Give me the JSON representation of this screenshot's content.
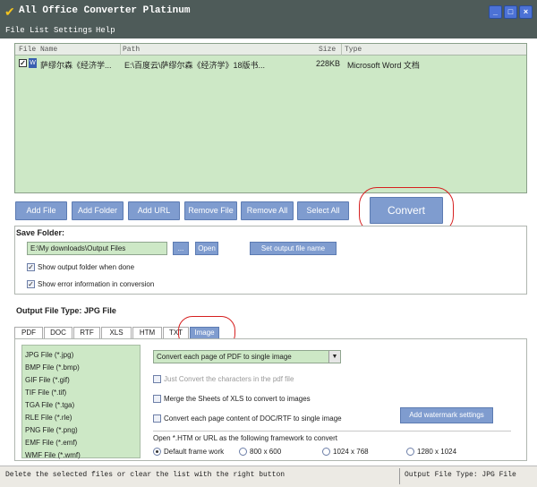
{
  "window": {
    "title": "All Office Converter Platinum",
    "minimize": "_",
    "maximize": "□",
    "close": "×"
  },
  "menu": [
    "File",
    "List",
    "Settings",
    "Help"
  ],
  "file_list": {
    "columns": [
      "File Name",
      "Path",
      "Size",
      "Type"
    ],
    "rows": [
      {
        "checked": true,
        "name": "萨缪尔森《经济学...",
        "path": "E:\\百度云\\萨缪尔森《经济学》18版书...",
        "size": "228KB",
        "type": "Microsoft Word 文档"
      }
    ]
  },
  "toolbar": {
    "add_file": "Add File",
    "add_folder": "Add Folder",
    "add_url": "Add URL",
    "remove_file": "Remove File",
    "remove_all": "Remove All",
    "select_all": "Select All",
    "convert": "Convert"
  },
  "save_folder": {
    "title": "Save Folder:",
    "path": "E:\\My downloads\\Output Files",
    "browse": "...",
    "open": "Open",
    "set_name": "Set output file name",
    "show_output_folder": "Show output folder when done",
    "show_error_info": "Show error information in conversion"
  },
  "output_type": "Output File Type:  JPG File",
  "tabs": [
    "PDF",
    "DOC",
    "RTF",
    "XLS",
    "HTM",
    "TXT",
    "Image"
  ],
  "image_formats": [
    "JPG File  (*.jpg)",
    "BMP File  (*.bmp)",
    "GIF File  (*.gif)",
    "TIF File  (*.tif)",
    "TGA File  (*.tga)",
    "RLE File  (*.rle)",
    "PNG File  (*.png)",
    "EMF File  (*.emf)",
    "WMF File  (*.wmf)"
  ],
  "image_options": {
    "pdf_mode": "Convert each page of PDF to single image",
    "just_convert_chars": "Just Convert the characters in the pdf file",
    "merge_xls": "Merge the Sheets of XLS to convert to images",
    "convert_doc_pages": "Convert each page content of DOC/RTF to single image",
    "watermark": "Add watermark settings",
    "open_htm_label": "Open *.HTM or URL as the following framework to convert",
    "frameworks": [
      "Default frame work",
      "800 x 600",
      "1024 x 768",
      "1280 x 1024"
    ]
  },
  "status": {
    "left": "Delete the selected files or clear the list with the right button",
    "right": "Output File Type:   JPG File"
  },
  "colors": {
    "titlebar": "#4e5b59",
    "list_bg": "#cde8c6",
    "button": "#7f9ccf",
    "highlight_ring": "#d62020"
  }
}
